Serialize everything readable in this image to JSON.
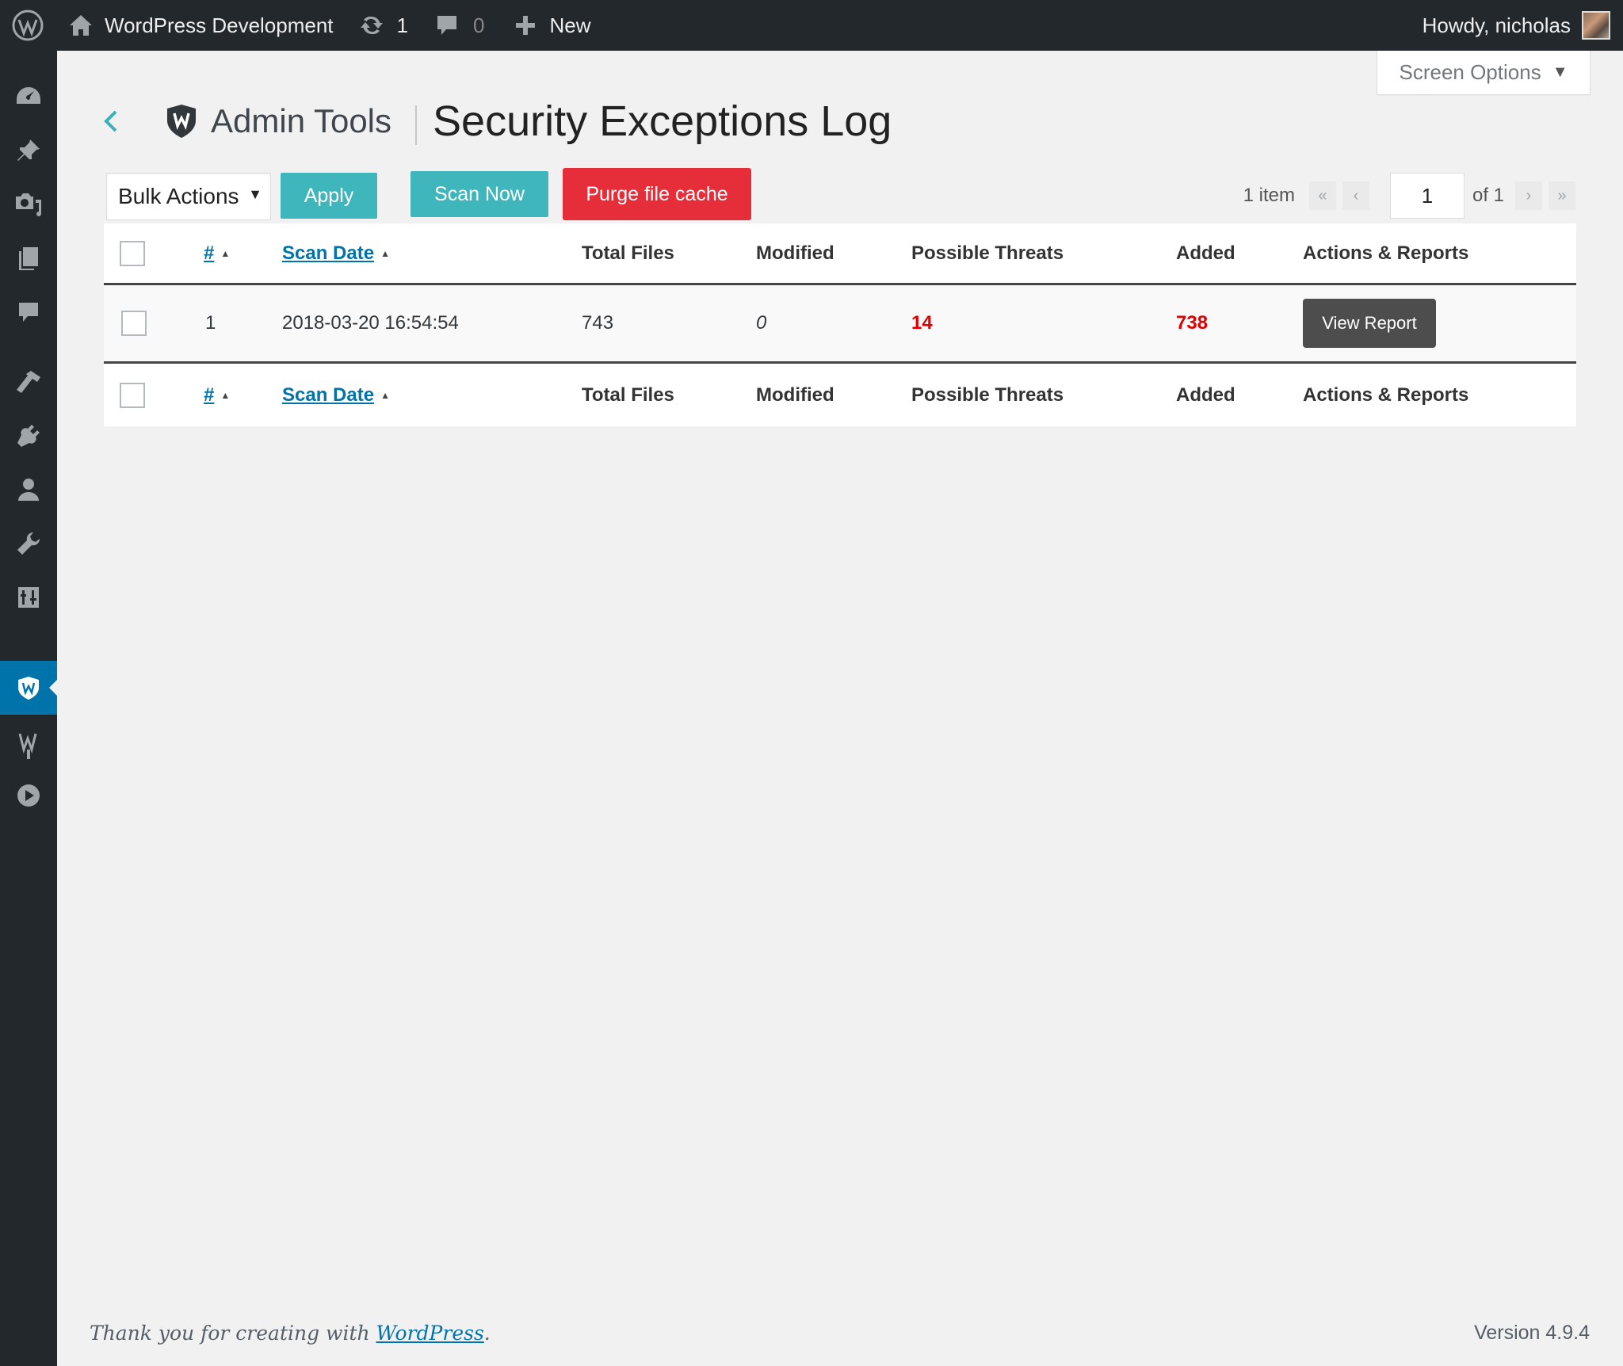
{
  "adminbar": {
    "site_name": "WordPress Development",
    "updates_count": "1",
    "comments_count": "0",
    "new_label": "New",
    "howdy": "Howdy, nicholas"
  },
  "screen_options": {
    "label": "Screen Options"
  },
  "header": {
    "brand": "Admin Tools",
    "title": "Security Exceptions Log"
  },
  "toolbar": {
    "bulk_actions": "Bulk Actions",
    "apply": "Apply",
    "scan_now": "Scan Now",
    "purge": "Purge file cache"
  },
  "pagination": {
    "items": "1 item",
    "first": "«",
    "prev": "‹",
    "current_page": "1",
    "of": "of 1",
    "next": "›",
    "last": "»"
  },
  "table": {
    "columns": {
      "id": "#",
      "scan_date": "Scan Date",
      "total_files": "Total Files",
      "modified": "Modified",
      "threats": "Possible Threats",
      "added": "Added",
      "actions": "Actions & Reports"
    },
    "rows": [
      {
        "id": "1",
        "scan_date": "2018-03-20 16:54:54",
        "total_files": "743",
        "modified": "0",
        "threats": "14",
        "added": "738",
        "action": "View Report"
      }
    ]
  },
  "footer": {
    "thanks_prefix": "Thank you for creating with ",
    "thanks_link": "WordPress",
    "thanks_suffix": ".",
    "version": "Version 4.9.4"
  },
  "colors": {
    "accent": "#3fb6bc",
    "danger": "#e52e3a",
    "threat": "#e10000",
    "link": "#0073aa"
  }
}
